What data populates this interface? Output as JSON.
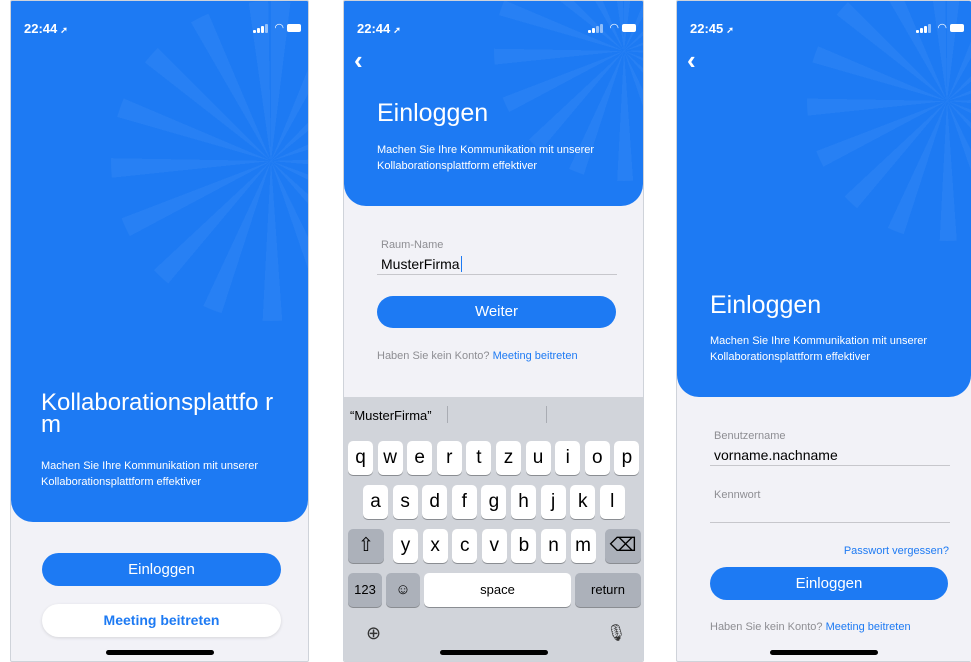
{
  "colors": {
    "accent": "#1d7af3",
    "background": "#f2f2f7"
  },
  "screen1": {
    "time": "22:44",
    "title": "Kollaborationsplattfo rm",
    "subtitle": "Machen Sie Ihre Kommunikation mit unserer Kollaborationsplattform effektiver",
    "login_button": "Einloggen",
    "join_button": "Meeting beitreten"
  },
  "screen2": {
    "time": "22:44",
    "title": "Einloggen",
    "subtitle": "Machen Sie Ihre Kommunikation mit unserer Kollaborationsplattform effektiver",
    "room_label": "Raum-Name",
    "room_value": "MusterFirma",
    "next_button": "Weiter",
    "no_account": "Haben Sie kein Konto?",
    "join_link": "Meeting beitreten",
    "keyboard": {
      "suggestion": "“MusterFirma”",
      "row1": [
        "q",
        "w",
        "e",
        "r",
        "t",
        "z",
        "u",
        "i",
        "o",
        "p"
      ],
      "row2": [
        "a",
        "s",
        "d",
        "f",
        "g",
        "h",
        "j",
        "k",
        "l"
      ],
      "row3": [
        "y",
        "x",
        "c",
        "v",
        "b",
        "n",
        "m"
      ],
      "numbers_key": "123",
      "space_key": "space",
      "return_key": "return"
    }
  },
  "screen3": {
    "time": "22:45",
    "title": "Einloggen",
    "subtitle": "Machen Sie Ihre Kommunikation mit unserer Kollaborationsplattform effektiver",
    "username_label": "Benutzername",
    "username_value": "vorname.nachname",
    "password_label": "Kennwort",
    "forgot_password": "Passwort vergessen?",
    "login_button": "Einloggen",
    "no_account": "Haben Sie kein Konto?",
    "join_link": "Meeting beitreten"
  }
}
